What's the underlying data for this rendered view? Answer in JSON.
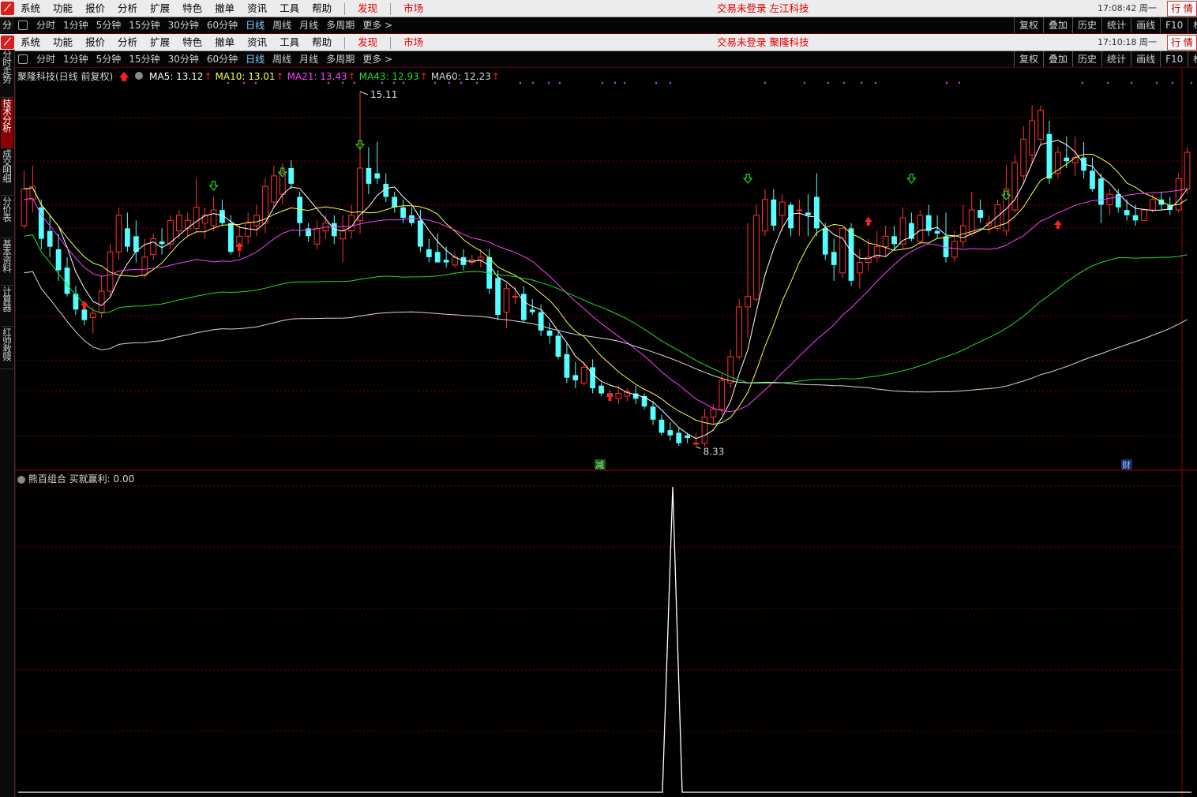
{
  "window1": {
    "menus": [
      "系统",
      "功能",
      "报价",
      "分析",
      "扩展",
      "特色",
      "撤单",
      "资讯",
      "工具",
      "帮助"
    ],
    "discover": "发现",
    "market": "市场",
    "status": "交易未登录  左江科技",
    "clock": "17:08:42 周一",
    "trade": "行 情"
  },
  "window2": {
    "menus": [
      "系统",
      "功能",
      "报价",
      "分析",
      "扩展",
      "特色",
      "撤单",
      "资讯",
      "工具",
      "帮助"
    ],
    "discover": "发现",
    "market": "市场",
    "status": "交易未登录  聚隆科技",
    "clock": "17:10:18 周一",
    "trade": "行 情"
  },
  "period_bar": {
    "lead": "分",
    "periods": [
      "分时",
      "1分钟",
      "5分钟",
      "15分钟",
      "30分钟",
      "60分钟",
      "日线",
      "周线",
      "月线",
      "多周期",
      "更多 >"
    ],
    "active": "日线",
    "tools": [
      "复权",
      "叠加",
      "历史",
      "统计",
      "画线",
      "F10",
      "标记"
    ]
  },
  "sidebar": [
    {
      "label": "分时走势",
      "active": false
    },
    {
      "label": "技术分析",
      "active": true
    },
    {
      "label": "成交明细",
      "active": false
    },
    {
      "label": "分价表",
      "active": false
    },
    {
      "label": "基本资料",
      "active": false
    },
    {
      "label": "计算器",
      "active": false
    },
    {
      "label": "红帅救赎",
      "active": false
    }
  ],
  "main_legend": {
    "title": "聚隆科技(日线 前复权)",
    "ma": [
      {
        "text": "MA5: 13.12",
        "color": "#ffffff"
      },
      {
        "text": "MA10: 13.01",
        "color": "#ffff40"
      },
      {
        "text": "MA21: 13.43",
        "color": "#ff40ff"
      },
      {
        "text": "MA43: 12.93",
        "color": "#20e020"
      },
      {
        "text": "MA60: 12.23",
        "color": "#d8d8d8"
      }
    ]
  },
  "annotations": {
    "high": "15.11",
    "low": "8.33",
    "tag_left": "减",
    "tag_right": "财"
  },
  "sub_legend": {
    "title": "熊百组合",
    "indicator": "买就赢利: 0.00"
  },
  "colors": {
    "up": "#ff3232",
    "down": "#54ffff",
    "ma5": "#ffffff",
    "ma10": "#ffff40",
    "ma21": "#ff40ff",
    "ma43": "#20e020",
    "ma60": "#d8d8d8",
    "grid": "#7a0000"
  },
  "chart_data": {
    "type": "candlestick",
    "price_range": [
      8.33,
      15.11
    ],
    "candles": [
      {
        "o": 12.55,
        "h": 13.6,
        "l": 12.5,
        "c": 13.25
      },
      {
        "o": 13.05,
        "h": 13.7,
        "l": 12.8,
        "c": 13.3
      },
      {
        "o": 12.9,
        "h": 13.05,
        "l": 12.1,
        "c": 12.3
      },
      {
        "o": 12.45,
        "h": 12.75,
        "l": 11.95,
        "c": 12.15
      },
      {
        "o": 12.1,
        "h": 12.4,
        "l": 11.5,
        "c": 11.7
      },
      {
        "o": 11.75,
        "h": 11.95,
        "l": 11.2,
        "c": 11.25
      },
      {
        "o": 11.25,
        "h": 11.4,
        "l": 10.85,
        "c": 10.95
      },
      {
        "o": 10.95,
        "h": 11.1,
        "l": 10.65,
        "c": 10.75
      },
      {
        "o": 10.8,
        "h": 11.0,
        "l": 10.5,
        "c": 10.88
      },
      {
        "o": 10.9,
        "h": 11.6,
        "l": 10.8,
        "c": 11.3
      },
      {
        "o": 11.3,
        "h": 12.2,
        "l": 11.2,
        "c": 12.05
      },
      {
        "o": 12.05,
        "h": 12.9,
        "l": 11.9,
        "c": 12.75
      },
      {
        "o": 12.5,
        "h": 12.8,
        "l": 12.05,
        "c": 12.15
      },
      {
        "o": 12.35,
        "h": 12.65,
        "l": 11.85,
        "c": 12.05
      },
      {
        "o": 11.6,
        "h": 12.3,
        "l": 11.55,
        "c": 11.95
      },
      {
        "o": 12.0,
        "h": 12.4,
        "l": 11.9,
        "c": 12.3
      },
      {
        "o": 12.25,
        "h": 12.5,
        "l": 12.0,
        "c": 12.2
      },
      {
        "o": 12.2,
        "h": 12.75,
        "l": 12.1,
        "c": 12.65
      },
      {
        "o": 12.45,
        "h": 12.85,
        "l": 12.3,
        "c": 12.75
      },
      {
        "o": 12.5,
        "h": 12.8,
        "l": 12.35,
        "c": 12.65
      },
      {
        "o": 12.5,
        "h": 13.45,
        "l": 12.4,
        "c": 12.9
      },
      {
        "o": 12.6,
        "h": 12.9,
        "l": 12.3,
        "c": 12.75
      },
      {
        "o": 12.55,
        "h": 13.1,
        "l": 12.45,
        "c": 12.85
      },
      {
        "o": 12.85,
        "h": 13.05,
        "l": 12.55,
        "c": 12.6
      },
      {
        "o": 12.6,
        "h": 12.75,
        "l": 12.0,
        "c": 12.05
      },
      {
        "o": 12.15,
        "h": 12.55,
        "l": 11.95,
        "c": 12.35
      },
      {
        "o": 12.35,
        "h": 12.8,
        "l": 12.2,
        "c": 12.6
      },
      {
        "o": 12.55,
        "h": 12.95,
        "l": 12.35,
        "c": 12.75
      },
      {
        "o": 12.6,
        "h": 13.45,
        "l": 12.4,
        "c": 13.3
      },
      {
        "o": 13.0,
        "h": 13.7,
        "l": 12.9,
        "c": 13.5
      },
      {
        "o": 13.15,
        "h": 13.75,
        "l": 12.95,
        "c": 13.55
      },
      {
        "o": 13.65,
        "h": 13.8,
        "l": 13.25,
        "c": 13.35
      },
      {
        "o": 13.1,
        "h": 13.2,
        "l": 12.35,
        "c": 12.6
      },
      {
        "o": 12.5,
        "h": 12.6,
        "l": 12.25,
        "c": 12.35
      },
      {
        "o": 12.2,
        "h": 12.65,
        "l": 12.1,
        "c": 12.5
      },
      {
        "o": 12.45,
        "h": 12.75,
        "l": 12.3,
        "c": 12.6
      },
      {
        "o": 12.6,
        "h": 12.75,
        "l": 12.2,
        "c": 12.35
      },
      {
        "o": 12.3,
        "h": 12.75,
        "l": 11.85,
        "c": 12.45
      },
      {
        "o": 12.45,
        "h": 12.95,
        "l": 12.3,
        "c": 12.75
      },
      {
        "o": 12.65,
        "h": 15.11,
        "l": 12.4,
        "c": 13.65
      },
      {
        "o": 13.65,
        "h": 14.05,
        "l": 13.15,
        "c": 13.35
      },
      {
        "o": 13.55,
        "h": 14.15,
        "l": 13.35,
        "c": 13.45
      },
      {
        "o": 13.35,
        "h": 13.55,
        "l": 13.0,
        "c": 13.1
      },
      {
        "o": 13.1,
        "h": 13.2,
        "l": 12.8,
        "c": 12.9
      },
      {
        "o": 12.9,
        "h": 13.05,
        "l": 12.6,
        "c": 12.7
      },
      {
        "o": 12.75,
        "h": 12.9,
        "l": 12.55,
        "c": 12.6
      },
      {
        "o": 12.65,
        "h": 12.85,
        "l": 12.05,
        "c": 12.15
      },
      {
        "o": 12.1,
        "h": 12.3,
        "l": 11.85,
        "c": 11.95
      },
      {
        "o": 12.05,
        "h": 12.4,
        "l": 11.85,
        "c": 11.85
      },
      {
        "o": 11.9,
        "h": 12.15,
        "l": 11.75,
        "c": 11.85
      },
      {
        "o": 11.8,
        "h": 12.05,
        "l": 11.75,
        "c": 11.95
      },
      {
        "o": 11.95,
        "h": 12.1,
        "l": 11.7,
        "c": 11.8
      },
      {
        "o": 11.85,
        "h": 12.0,
        "l": 11.8,
        "c": 11.9
      },
      {
        "o": 11.9,
        "h": 12.1,
        "l": 11.75,
        "c": 11.95
      },
      {
        "o": 11.95,
        "h": 12.1,
        "l": 11.25,
        "c": 11.35
      },
      {
        "o": 11.55,
        "h": 11.7,
        "l": 10.75,
        "c": 10.85
      },
      {
        "o": 10.9,
        "h": 11.45,
        "l": 10.6,
        "c": 11.35
      },
      {
        "o": 11.2,
        "h": 11.4,
        "l": 11.05,
        "c": 11.2
      },
      {
        "o": 11.25,
        "h": 11.4,
        "l": 10.7,
        "c": 10.75
      },
      {
        "o": 10.95,
        "h": 11.15,
        "l": 10.85,
        "c": 10.9
      },
      {
        "o": 10.9,
        "h": 11.05,
        "l": 10.45,
        "c": 10.55
      },
      {
        "o": 10.55,
        "h": 10.7,
        "l": 10.3,
        "c": 10.45
      },
      {
        "o": 10.45,
        "h": 10.55,
        "l": 10.0,
        "c": 10.05
      },
      {
        "o": 10.1,
        "h": 10.3,
        "l": 9.55,
        "c": 9.65
      },
      {
        "o": 9.7,
        "h": 9.95,
        "l": 9.45,
        "c": 9.6
      },
      {
        "o": 9.55,
        "h": 9.95,
        "l": 9.5,
        "c": 9.85
      },
      {
        "o": 9.85,
        "h": 10.0,
        "l": 9.35,
        "c": 9.45
      },
      {
        "o": 9.5,
        "h": 9.55,
        "l": 9.3,
        "c": 9.35
      },
      {
        "o": 9.35,
        "h": 9.4,
        "l": 9.2,
        "c": 9.3
      },
      {
        "o": 9.25,
        "h": 9.5,
        "l": 9.15,
        "c": 9.35
      },
      {
        "o": 9.3,
        "h": 9.45,
        "l": 9.2,
        "c": 9.38
      },
      {
        "o": 9.35,
        "h": 9.5,
        "l": 9.15,
        "c": 9.25
      },
      {
        "o": 9.3,
        "h": 9.35,
        "l": 9.05,
        "c": 9.1
      },
      {
        "o": 9.1,
        "h": 9.2,
        "l": 8.75,
        "c": 8.85
      },
      {
        "o": 8.85,
        "h": 8.95,
        "l": 8.55,
        "c": 8.6
      },
      {
        "o": 8.65,
        "h": 8.8,
        "l": 8.45,
        "c": 8.55
      },
      {
        "o": 8.6,
        "h": 8.7,
        "l": 8.35,
        "c": 8.4
      },
      {
        "o": 8.55,
        "h": 8.6,
        "l": 8.4,
        "c": 8.5
      },
      {
        "o": 8.4,
        "h": 8.6,
        "l": 8.33,
        "c": 8.4
      },
      {
        "o": 8.4,
        "h": 9.05,
        "l": 8.33,
        "c": 8.9
      },
      {
        "o": 8.9,
        "h": 9.15,
        "l": 8.75,
        "c": 9.05
      },
      {
        "o": 9.05,
        "h": 9.75,
        "l": 8.95,
        "c": 9.6
      },
      {
        "o": 9.55,
        "h": 10.2,
        "l": 9.45,
        "c": 10.05
      },
      {
        "o": 10.05,
        "h": 11.15,
        "l": 10.0,
        "c": 11.0
      },
      {
        "o": 11.0,
        "h": 12.6,
        "l": 10.4,
        "c": 11.2
      },
      {
        "o": 11.15,
        "h": 12.95,
        "l": 11.1,
        "c": 12.75
      },
      {
        "o": 12.45,
        "h": 13.25,
        "l": 12.35,
        "c": 13.05
      },
      {
        "o": 13.05,
        "h": 13.25,
        "l": 12.45,
        "c": 12.55
      },
      {
        "o": 12.75,
        "h": 13.15,
        "l": 12.45,
        "c": 13.0
      },
      {
        "o": 12.95,
        "h": 13.0,
        "l": 12.35,
        "c": 12.5
      },
      {
        "o": 12.85,
        "h": 13.05,
        "l": 12.35,
        "c": 12.85
      },
      {
        "o": 12.8,
        "h": 13.15,
        "l": 12.35,
        "c": 12.75
      },
      {
        "o": 13.1,
        "h": 13.55,
        "l": 12.35,
        "c": 12.5
      },
      {
        "o": 12.5,
        "h": 12.6,
        "l": 11.9,
        "c": 12.0
      },
      {
        "o": 12.05,
        "h": 12.3,
        "l": 11.5,
        "c": 11.8
      },
      {
        "o": 11.65,
        "h": 12.45,
        "l": 11.55,
        "c": 12.5
      },
      {
        "o": 12.5,
        "h": 12.6,
        "l": 11.4,
        "c": 11.5
      },
      {
        "o": 11.65,
        "h": 12.1,
        "l": 11.35,
        "c": 11.85
      },
      {
        "o": 11.85,
        "h": 12.3,
        "l": 11.7,
        "c": 11.95
      },
      {
        "o": 11.95,
        "h": 12.45,
        "l": 11.85,
        "c": 12.15
      },
      {
        "o": 12.15,
        "h": 12.55,
        "l": 11.95,
        "c": 12.35
      },
      {
        "o": 12.35,
        "h": 12.55,
        "l": 12.1,
        "c": 12.2
      },
      {
        "o": 12.2,
        "h": 12.9,
        "l": 12.1,
        "c": 12.7
      },
      {
        "o": 12.6,
        "h": 12.8,
        "l": 12.25,
        "c": 12.3
      },
      {
        "o": 12.25,
        "h": 12.85,
        "l": 12.2,
        "c": 12.75
      },
      {
        "o": 12.75,
        "h": 12.95,
        "l": 12.35,
        "c": 12.45
      },
      {
        "o": 12.45,
        "h": 12.75,
        "l": 12.3,
        "c": 12.4
      },
      {
        "o": 12.35,
        "h": 12.8,
        "l": 11.85,
        "c": 11.95
      },
      {
        "o": 11.95,
        "h": 12.45,
        "l": 11.85,
        "c": 12.25
      },
      {
        "o": 12.25,
        "h": 12.95,
        "l": 12.15,
        "c": 12.55
      },
      {
        "o": 12.4,
        "h": 13.2,
        "l": 12.35,
        "c": 12.85
      },
      {
        "o": 12.85,
        "h": 13.05,
        "l": 12.6,
        "c": 12.7
      },
      {
        "o": 12.55,
        "h": 12.75,
        "l": 12.4,
        "c": 12.6
      },
      {
        "o": 12.5,
        "h": 13.05,
        "l": 12.45,
        "c": 12.95
      },
      {
        "o": 12.45,
        "h": 13.7,
        "l": 12.35,
        "c": 13.25
      },
      {
        "o": 12.85,
        "h": 13.9,
        "l": 12.8,
        "c": 13.75
      },
      {
        "o": 13.5,
        "h": 14.45,
        "l": 13.35,
        "c": 14.2
      },
      {
        "o": 13.9,
        "h": 14.85,
        "l": 13.75,
        "c": 14.55
      },
      {
        "o": 14.2,
        "h": 14.85,
        "l": 14.1,
        "c": 14.75
      },
      {
        "o": 14.3,
        "h": 14.55,
        "l": 13.35,
        "c": 13.45
      },
      {
        "o": 13.55,
        "h": 14.05,
        "l": 13.45,
        "c": 13.95
      },
      {
        "o": 13.85,
        "h": 14.25,
        "l": 13.65,
        "c": 13.78
      },
      {
        "o": 13.75,
        "h": 14.25,
        "l": 13.5,
        "c": 13.85
      },
      {
        "o": 13.85,
        "h": 14.15,
        "l": 13.45,
        "c": 13.6
      },
      {
        "o": 13.6,
        "h": 13.85,
        "l": 13.2,
        "c": 13.25
      },
      {
        "o": 13.45,
        "h": 13.55,
        "l": 12.6,
        "c": 12.95
      },
      {
        "o": 12.95,
        "h": 13.25,
        "l": 12.75,
        "c": 13.15
      },
      {
        "o": 13.15,
        "h": 13.25,
        "l": 12.8,
        "c": 12.9
      },
      {
        "o": 12.85,
        "h": 13.05,
        "l": 12.65,
        "c": 12.75
      },
      {
        "o": 12.75,
        "h": 12.95,
        "l": 12.55,
        "c": 12.65
      },
      {
        "o": 12.65,
        "h": 12.85,
        "l": 12.65,
        "c": 12.85
      },
      {
        "o": 12.85,
        "h": 13.15,
        "l": 12.8,
        "c": 13.05
      },
      {
        "o": 13.05,
        "h": 13.2,
        "l": 12.85,
        "c": 12.95
      },
      {
        "o": 12.95,
        "h": 13.1,
        "l": 12.75,
        "c": 12.85
      },
      {
        "o": 12.85,
        "h": 13.55,
        "l": 12.8,
        "c": 13.45
      },
      {
        "o": 13.25,
        "h": 14.05,
        "l": 13.15,
        "c": 13.95
      }
    ]
  }
}
